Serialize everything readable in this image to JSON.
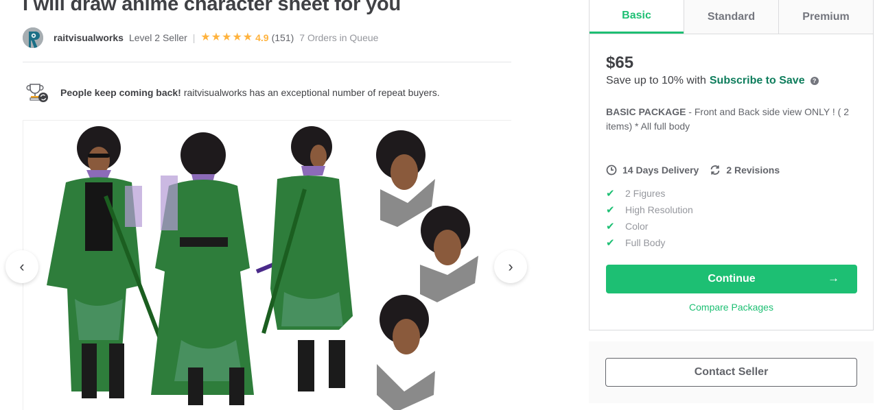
{
  "gig": {
    "title": "I will draw anime character sheet for you"
  },
  "seller": {
    "avatar_icon": "seller-avatar",
    "name": "raitvisualworks",
    "level": "Level 2 Seller",
    "separator": "|",
    "stars": 5,
    "star_glyph": "★",
    "rating": "4.9",
    "rating_count": "(151)",
    "orders_in_queue": "7 Orders in Queue"
  },
  "highlight": {
    "icon": "trophy-repeat-icon",
    "strong": "People keep coming back!",
    "text": "raitvisualworks has an exceptional number of repeat buyers."
  },
  "gallery": {
    "image_alt": "Anime character sheet: green kimono character front, back, side views and three face expressions",
    "prev_label": "‹",
    "next_label": "›"
  },
  "packages": {
    "tabs": [
      {
        "label": "Basic",
        "active": true
      },
      {
        "label": "Standard",
        "active": false
      },
      {
        "label": "Premium",
        "active": false
      }
    ],
    "price": "$65",
    "save_text": "Save up to 10% with",
    "save_link": "Subscribe to Save",
    "help_icon": "?",
    "description_title": "BASIC PACKAGE",
    "description_text": " - Front and Back side view ONLY ! ( 2 items) * All full body",
    "delivery": "14 Days Delivery",
    "revisions": "2 Revisions",
    "features": [
      "2 Figures",
      "High Resolution",
      "Color",
      "Full Body"
    ],
    "check_glyph": "✔",
    "continue_label": "Continue",
    "continue_arrow": "→",
    "compare_label": "Compare Packages"
  },
  "contact": {
    "label": "Contact Seller"
  },
  "colors": {
    "brand_green": "#1dbf73",
    "link_dark_green": "#0e7d5c",
    "star_yellow": "#ffb33e",
    "text_dark": "#404145",
    "text_muted": "#95979d"
  }
}
